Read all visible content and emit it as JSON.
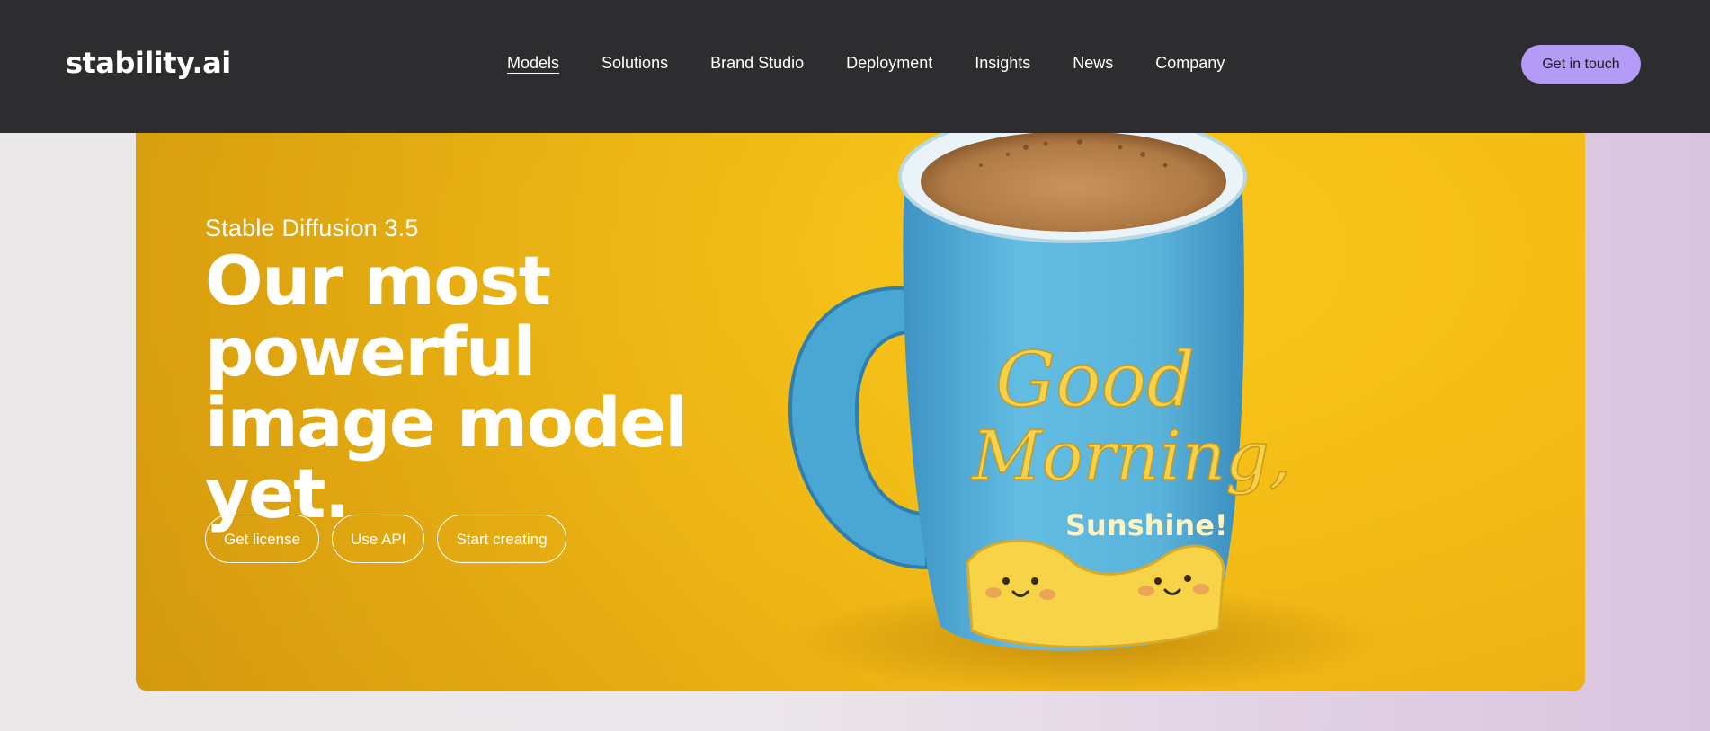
{
  "brand": {
    "logo_text": "stability.ai"
  },
  "nav": {
    "items": [
      {
        "label": "Models",
        "active": true
      },
      {
        "label": "Solutions",
        "active": false
      },
      {
        "label": "Brand Studio",
        "active": false
      },
      {
        "label": "Deployment",
        "active": false
      },
      {
        "label": "Insights",
        "active": false
      },
      {
        "label": "News",
        "active": false
      },
      {
        "label": "Company",
        "active": false
      }
    ],
    "cta_label": "Get in touch"
  },
  "hero": {
    "eyebrow": "Stable Diffusion 3.5",
    "headline": "Our most powerful image model yet.",
    "buttons": [
      {
        "label": "Get license"
      },
      {
        "label": "Use API"
      },
      {
        "label": "Start creating"
      }
    ],
    "image": {
      "subject": "mug-illustration",
      "mug_text_line1": "Good",
      "mug_text_line2": "Morning,",
      "mug_text_line3": "Sunshine!"
    }
  },
  "colors": {
    "nav_background": "#2d2d2f",
    "cta_background": "#b49bf7",
    "hero_background": "#f4bd16",
    "mug_blue": "#5cb6dd",
    "mug_lettering": "#f6d24a"
  }
}
